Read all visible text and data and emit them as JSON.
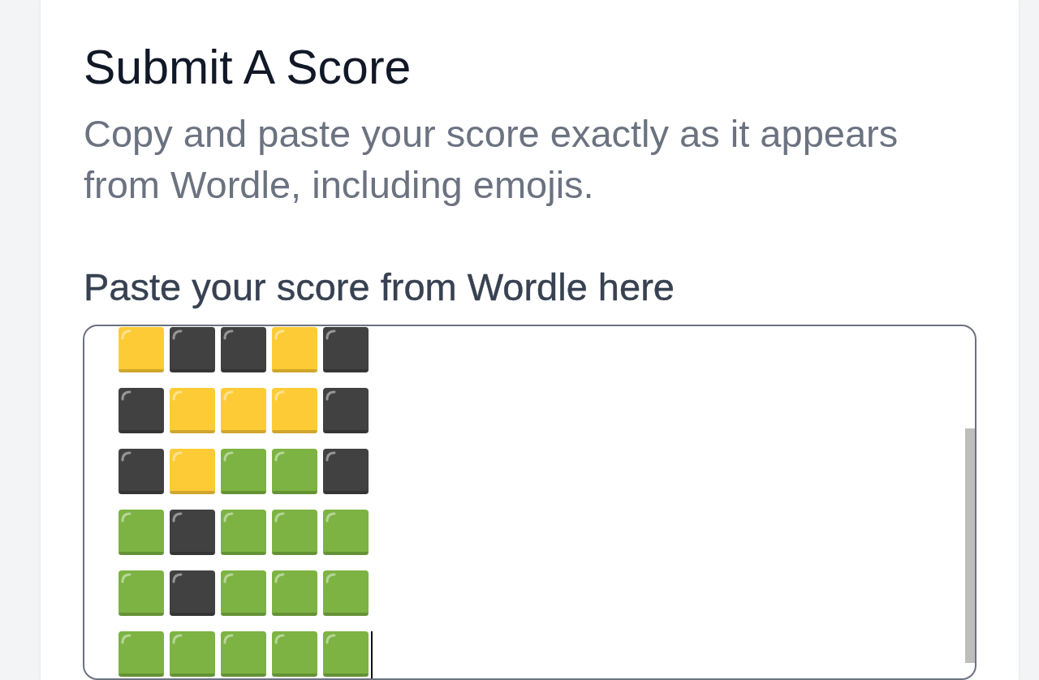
{
  "card": {
    "title": "Submit A Score",
    "description": "Copy and paste your score exactly as it appears from Wordle, including emojis.",
    "score_field": {
      "label": "Paste your score from Wordle here",
      "focused": true,
      "rows": [
        {
          "tiles": [
            {
              "color": "#fdcb35"
            },
            {
              "color": "#414141"
            },
            {
              "color": "#414141"
            },
            {
              "color": "#fdcb35"
            },
            {
              "color": "#414141"
            }
          ]
        },
        {
          "tiles": [
            {
              "color": "#414141"
            },
            {
              "color": "#fdcb35"
            },
            {
              "color": "#fdcb35"
            },
            {
              "color": "#fdcb35"
            },
            {
              "color": "#414141"
            }
          ]
        },
        {
          "tiles": [
            {
              "color": "#414141"
            },
            {
              "color": "#fdcb35"
            },
            {
              "color": "#7cb342"
            },
            {
              "color": "#7cb342"
            },
            {
              "color": "#414141"
            }
          ]
        },
        {
          "tiles": [
            {
              "color": "#7cb342"
            },
            {
              "color": "#414141"
            },
            {
              "color": "#7cb342"
            },
            {
              "color": "#7cb342"
            },
            {
              "color": "#7cb342"
            }
          ]
        },
        {
          "tiles": [
            {
              "color": "#7cb342"
            },
            {
              "color": "#414141"
            },
            {
              "color": "#7cb342"
            },
            {
              "color": "#7cb342"
            },
            {
              "color": "#7cb342"
            }
          ]
        },
        {
          "tiles": [
            {
              "color": "#7cb342"
            },
            {
              "color": "#7cb342"
            },
            {
              "color": "#7cb342"
            },
            {
              "color": "#7cb342"
            },
            {
              "color": "#7cb342"
            }
          ]
        }
      ]
    }
  }
}
